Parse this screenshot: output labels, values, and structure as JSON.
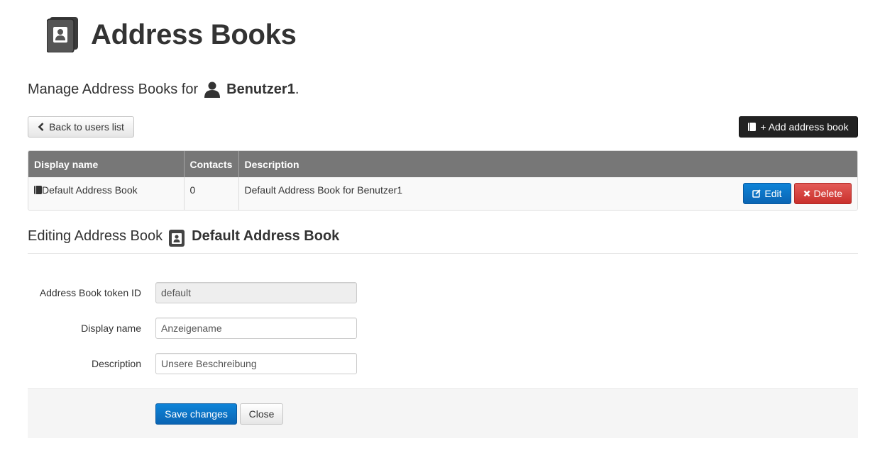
{
  "header": {
    "title": "Address Books",
    "icon": "address-book-icon"
  },
  "manage": {
    "prefix": "Manage Address Books for",
    "user_icon": "user-icon",
    "username": "Benutzer1",
    "suffix": "."
  },
  "toolbar": {
    "back_label": "Back to users list",
    "add_label": "+ Add address book"
  },
  "table": {
    "columns": [
      "Display name",
      "Contacts",
      "Description"
    ],
    "rows": [
      {
        "display_name": "Default Address Book",
        "contacts": "0",
        "description": "Default Address Book for Benutzer1",
        "edit_label": "Edit",
        "delete_label": "Delete"
      }
    ]
  },
  "editing": {
    "prefix": "Editing Address Book",
    "book_name": "Default Address Book",
    "fields": {
      "token_label": "Address Book token ID",
      "token_value": "default",
      "display_label": "Display name",
      "display_value": "Anzeigename",
      "description_label": "Description",
      "description_value": "Unsere Beschreibung"
    },
    "save_label": "Save changes",
    "close_label": "Close"
  },
  "colors": {
    "table_header": "#777777",
    "primary": "#0a6ebd",
    "danger": "#d9534f",
    "dark_button": "#222222"
  }
}
